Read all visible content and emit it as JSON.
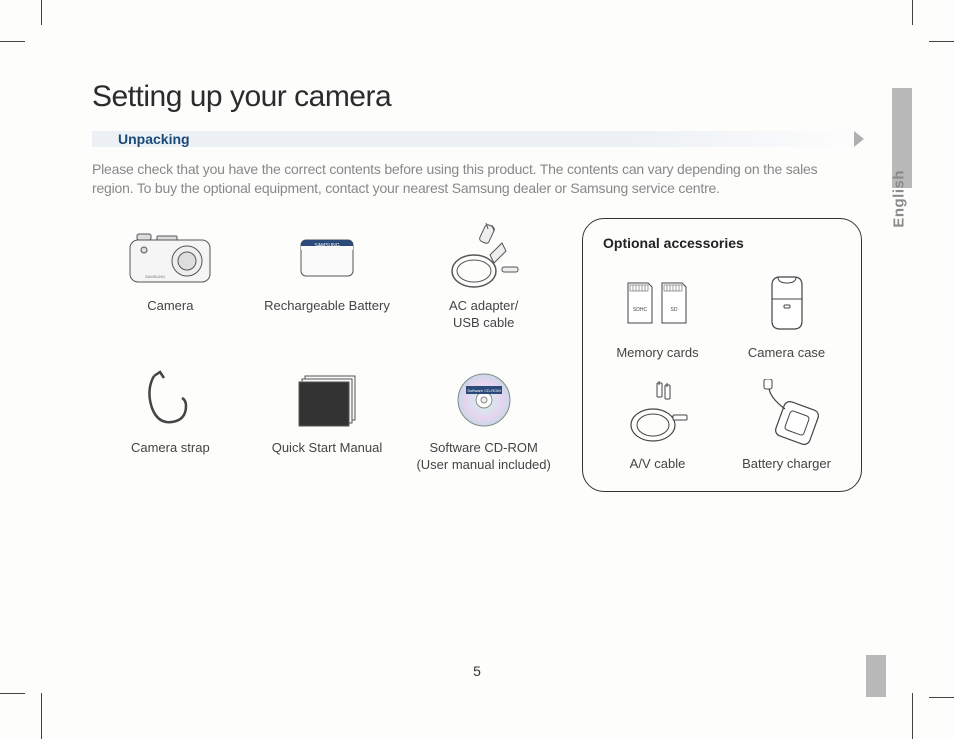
{
  "language_tab": "English",
  "page_number": "5",
  "title": "Setting up your camera",
  "section_heading": "Unpacking",
  "intro_text": "Please check that you have the correct contents before using this product. The contents can vary depending on the sales region. To buy the optional equipment, contact your nearest Samsung dealer or Samsung service centre.",
  "included_items": [
    {
      "label": "Camera"
    },
    {
      "label": "Rechargeable Battery"
    },
    {
      "label": "AC adapter/\nUSB cable"
    },
    {
      "label": "Camera strap"
    },
    {
      "label": "Quick Start Manual"
    },
    {
      "label": "Software CD-ROM\n(User manual included)"
    }
  ],
  "optional_title": "Optional accessories",
  "optional_items": [
    {
      "label": "Memory cards"
    },
    {
      "label": "Camera case"
    },
    {
      "label": "A/V cable"
    },
    {
      "label": "Battery charger"
    }
  ],
  "battery_brand": "SAMSUNG",
  "cd_label": "Software CD-ROM",
  "sd_labels": {
    "sdhc": "SDHC",
    "sd": "SD"
  }
}
